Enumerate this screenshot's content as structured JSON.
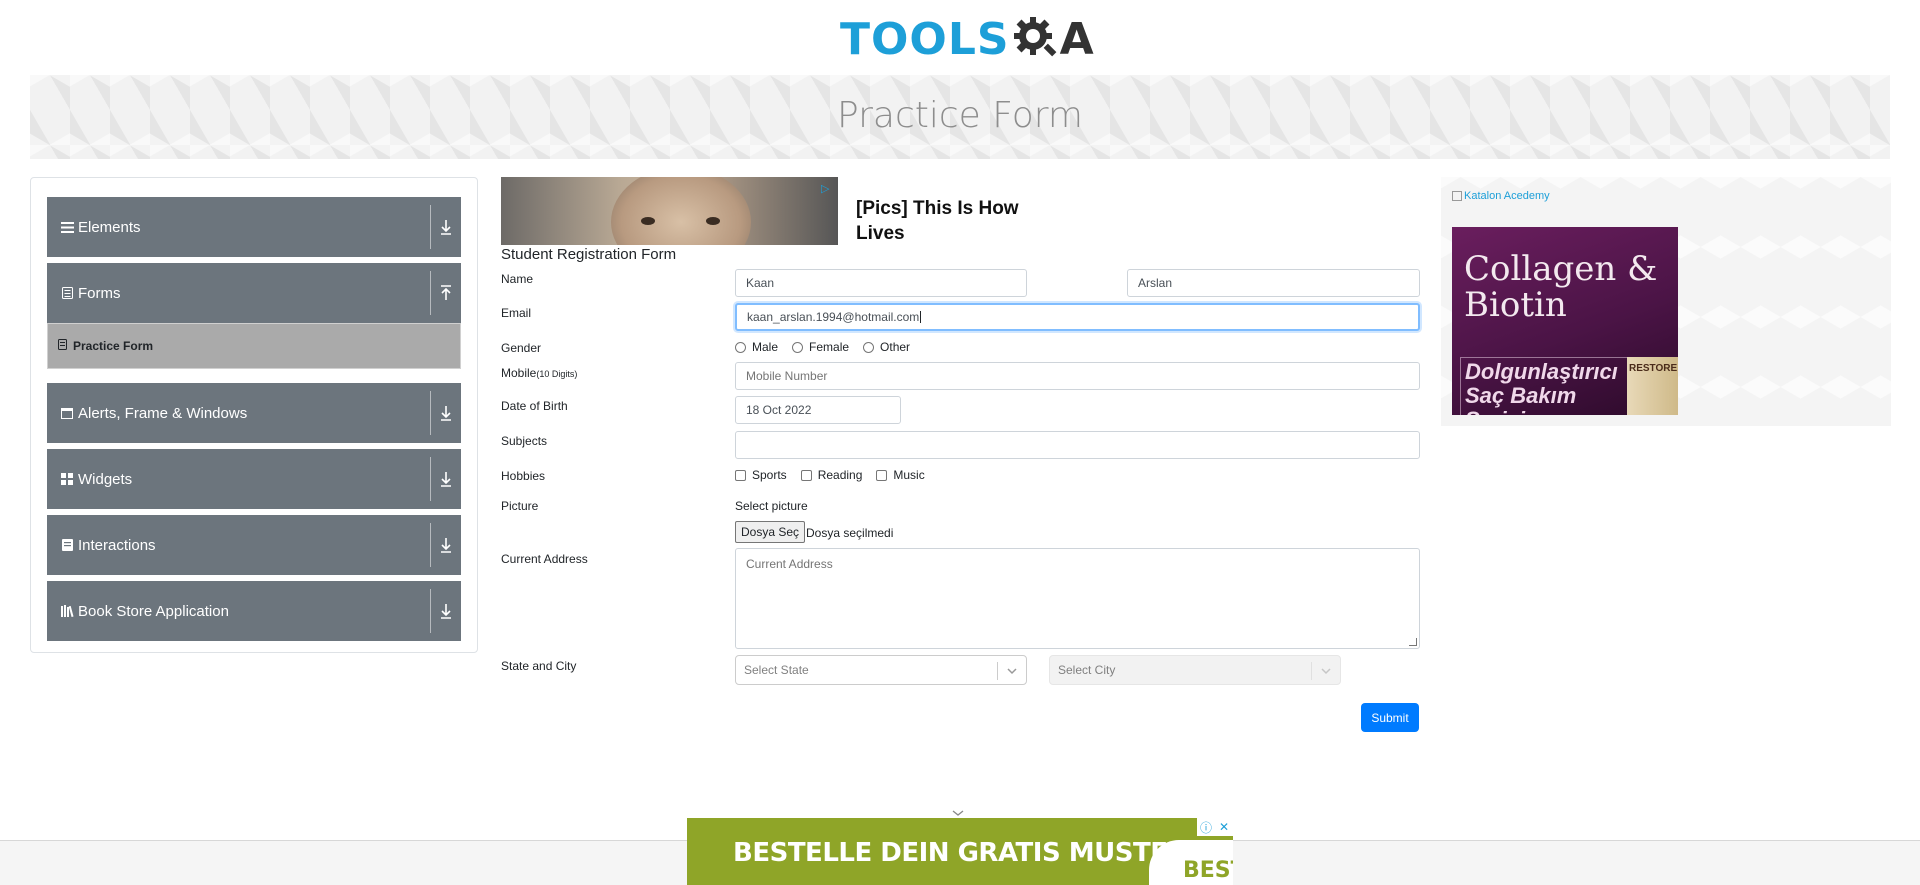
{
  "header": {
    "logo_text": "TOOLS",
    "logo_a": "A",
    "page_title": "Practice Form"
  },
  "sidebar": {
    "groups": [
      {
        "label": "Elements"
      },
      {
        "label": "Forms"
      },
      {
        "label": "Alerts, Frame & Windows"
      },
      {
        "label": "Widgets"
      },
      {
        "label": "Interactions"
      },
      {
        "label": "Book Store Application"
      }
    ],
    "active_item": "Practice Form"
  },
  "ad_top": {
    "headline": "[Pics] This Is How Lives"
  },
  "form": {
    "title": "Student Registration Form",
    "name_label": "Name",
    "first_name": "Kaan",
    "last_name": "Arslan",
    "email_label": "Email",
    "email": "kaan_arslan.1994@hotmail.com",
    "gender_label": "Gender",
    "gender_options": [
      "Male",
      "Female",
      "Other"
    ],
    "mobile_label": "Mobile",
    "mobile_hint": "(10 Digits)",
    "mobile_placeholder": "Mobile Number",
    "dob_label": "Date of Birth",
    "dob": "18 Oct 2022",
    "subjects_label": "Subjects",
    "hobbies_label": "Hobbies",
    "hobbies": [
      "Sports",
      "Reading",
      "Music"
    ],
    "picture_label": "Picture",
    "select_picture": "Select picture",
    "file_button": "Dosya Seç",
    "file_status": "Dosya seçilmedi",
    "address_label": "Current Address",
    "address_placeholder": "Current Address",
    "state_city_label": "State and City",
    "state_placeholder": "Select State",
    "city_placeholder": "Select City",
    "submit": "Submit"
  },
  "right_ad": {
    "link_text": "Katalon Acedemy",
    "title": "Collagen & Biotin",
    "subtitle": "Dolgunlaştırıcı Saç Bakım Serisi",
    "bottle_text": "RESTORE"
  },
  "bottom_ad": {
    "headline": "BESTELLE DEIN GRATIS MUSTER",
    "side_text": "BEST"
  },
  "colors": {
    "sidebar_group": "#6c757d",
    "sidebar_active": "#aaaaaa",
    "submit": "#007bff",
    "logo_blue": "#1d9fd8"
  }
}
